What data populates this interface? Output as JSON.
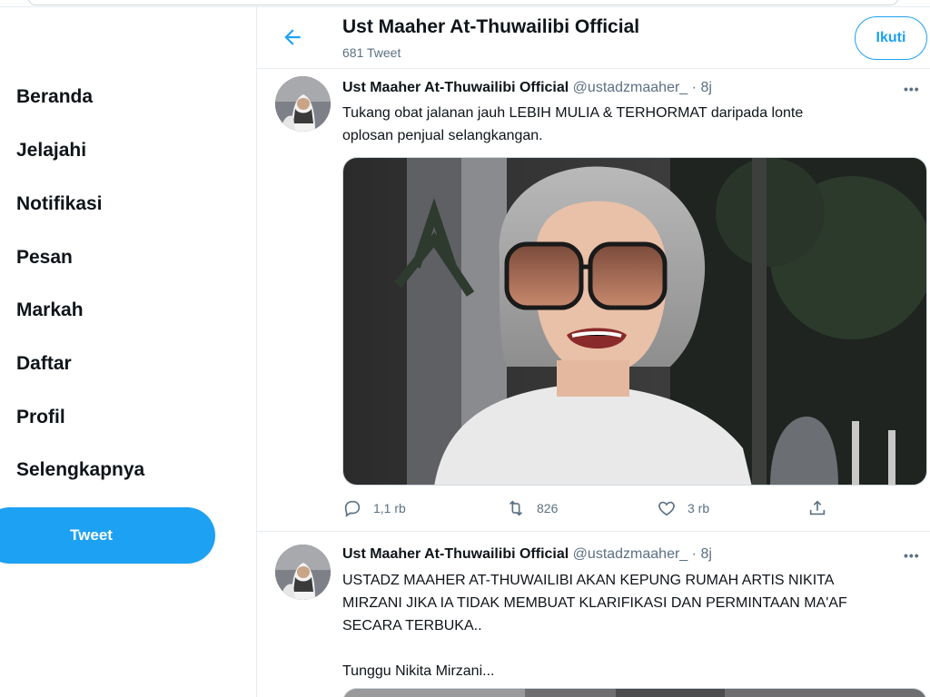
{
  "sidebar": {
    "items": [
      {
        "label": "Beranda"
      },
      {
        "label": "Jelajahi"
      },
      {
        "label": "Notifikasi"
      },
      {
        "label": "Pesan"
      },
      {
        "label": "Markah"
      },
      {
        "label": "Daftar"
      },
      {
        "label": "Profil"
      },
      {
        "label": "Selengkapnya"
      }
    ],
    "tweet_button": "Tweet"
  },
  "header": {
    "title": "Ust Maaher At-Thuwailibi Official",
    "subtitle": "681 Tweet",
    "follow_label": "Ikuti",
    "back_icon": "arrow-left-icon"
  },
  "tweets": [
    {
      "name": "Ust Maaher At-Thuwailibi Official",
      "handle": "@ustadzmaaher_",
      "separator": "·",
      "time": "8j",
      "more": "•••",
      "text_lines": [
        "Tukang obat jalanan jauh LEBIH MULIA & TERHORMAT daripada lonte",
        "oplosan penjual selangkangan."
      ],
      "replies": "1,1 rb",
      "retweets": "826",
      "likes": "3 rb"
    },
    {
      "name": "Ust Maaher At-Thuwailibi Official",
      "handle": "@ustadzmaaher_",
      "separator": "·",
      "time": "8j",
      "more": "•••",
      "text_lines": [
        "USTADZ MAAHER AT-THUWAILIBI AKAN KEPUNG RUMAH ARTIS NIKITA",
        "MIRZANI JIKA IA TIDAK MEMBUAT KLARIFIKASI DAN PERMINTAAN MA'AF",
        "SECARA TERBUKA..",
        "",
        "Tunggu Nikita Mirzani..."
      ]
    }
  ],
  "colors": {
    "accent": "#1da1f2",
    "text": "#0f1419",
    "muted": "#5b7083",
    "border": "#e6ecf0"
  }
}
